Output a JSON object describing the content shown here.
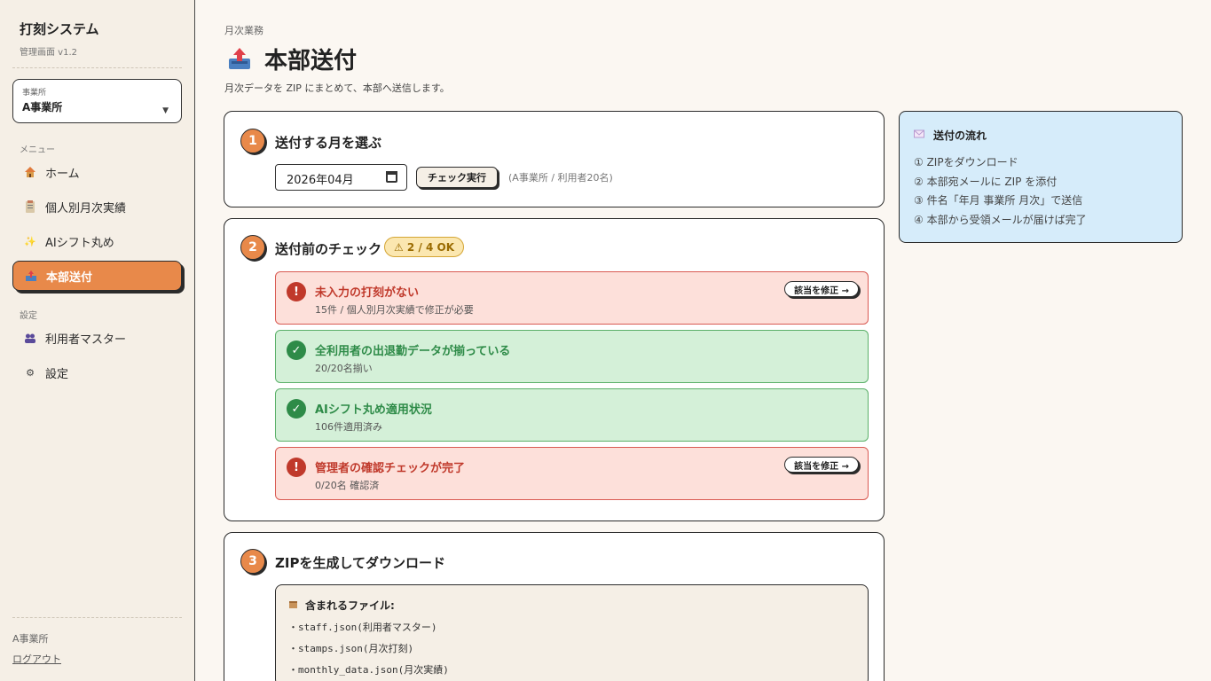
{
  "sidebar": {
    "app_title": "打刻システム",
    "app_subtitle": "管理画面 v1.2",
    "office_label": "事業所",
    "office_value": "A事業所",
    "menu_heading": "メニュー",
    "settings_heading": "設定",
    "items": [
      {
        "label": "ホーム",
        "icon": "home-icon"
      },
      {
        "label": "個人別月次実績",
        "icon": "clipboard-icon"
      },
      {
        "label": "AIシフト丸め",
        "icon": "sparkle-icon"
      },
      {
        "label": "本部送付",
        "icon": "outbox-icon",
        "active": true
      },
      {
        "label": "利用者マスター",
        "icon": "users-icon"
      },
      {
        "label": "設定",
        "icon": "gear-icon"
      }
    ],
    "footer_office": "A事業所",
    "logout_label": "ログアウト"
  },
  "header": {
    "breadcrumb": "月次業務",
    "title": "本部送付",
    "description": "月次データを ZIP にまとめて、本部へ送信します。"
  },
  "step1": {
    "number": "1",
    "title": "送付する月を選ぶ",
    "month_value": "2026年04月",
    "run_button": "チェック実行",
    "note": "(A事業所 / 利用者20名)"
  },
  "step2": {
    "number": "2",
    "title": "送付前のチェック",
    "badge": "⚠ 2 / 4 OK",
    "checks": [
      {
        "status": "bad",
        "title": "未入力の打刻がない",
        "sub": "15件 / 個人別月次実績で修正が必要",
        "action": "該当を修正 →"
      },
      {
        "status": "good",
        "title": "全利用者の出退勤データが揃っている",
        "sub": "20/20名揃い"
      },
      {
        "status": "good",
        "title": "AIシフト丸め適用状況",
        "sub": "106件適用済み"
      },
      {
        "status": "bad",
        "title": "管理者の確認チェックが完了",
        "sub": "0/20名 確認済",
        "action": "該当を修正 →"
      }
    ]
  },
  "step3": {
    "number": "3",
    "title": "ZIPを生成してダウンロード",
    "files_heading": "含まれるファイル:",
    "files": [
      "・staff.json(利用者マスター)",
      "・stamps.json(月次打刻)",
      "・monthly_data.json(月次実績)"
    ]
  },
  "flow": {
    "title": "送付の流れ",
    "steps": [
      "① ZIPをダウンロード",
      "② 本部宛メールに ZIP を添付",
      "③ 件名「年月 事業所 月次」で送信",
      "④ 本部から受領メールが届けば完了"
    ]
  },
  "colors": {
    "accent": "#e8894a",
    "error": "#c0392b",
    "success": "#2e8b48",
    "info_bg": "#d6ecfa"
  }
}
